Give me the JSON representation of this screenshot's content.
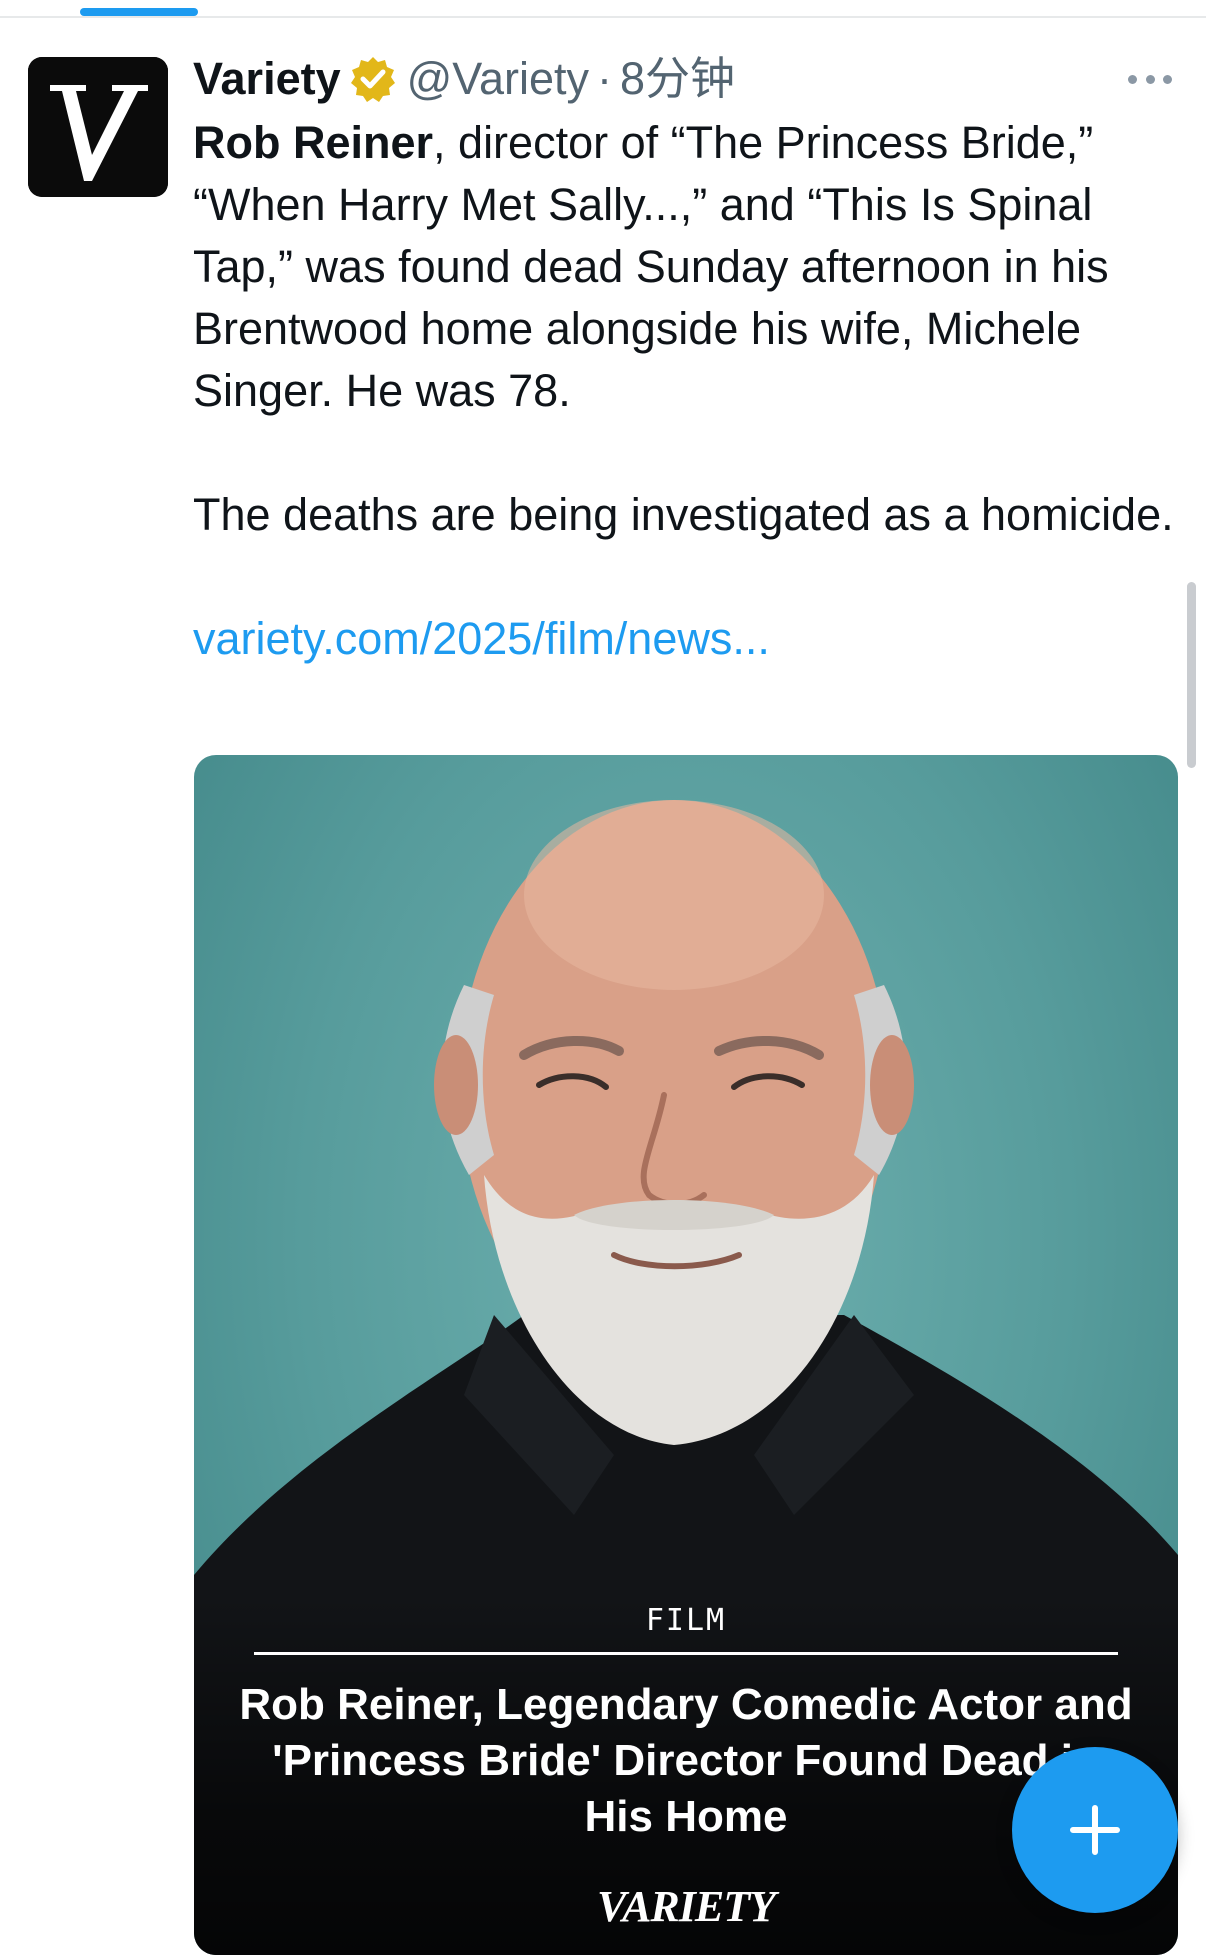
{
  "tweet": {
    "display_name": "Variety",
    "verified_icon": "verified-gold-badge-icon",
    "handle": "@Variety",
    "separator": "·",
    "time": "8分钟",
    "text_bold": "Rob Reiner",
    "text_rest": ", director of “The Princess Bride,” “When Harry Met Sally...,” and “This Is Spinal Tap,” was found dead Sunday afternoon in his Brentwood home alongside his wife, Michele Singer. He was 78.",
    "text_second": "The deaths are being investigated as a homicide.",
    "link": "variety.com/2025/film/news..."
  },
  "card": {
    "section": "FILM",
    "headline": "Rob Reiner, Legendary Comedic Actor and 'Princess Bride' Director Found Dead in His Home",
    "brand": "VARIETY"
  },
  "fab": {
    "icon": "plus-icon"
  },
  "colors": {
    "accent": "#1d9bf0",
    "text": "#0f1419",
    "muted": "#536471",
    "verified": "#e2b719",
    "photo_bg": "#579c9c"
  }
}
